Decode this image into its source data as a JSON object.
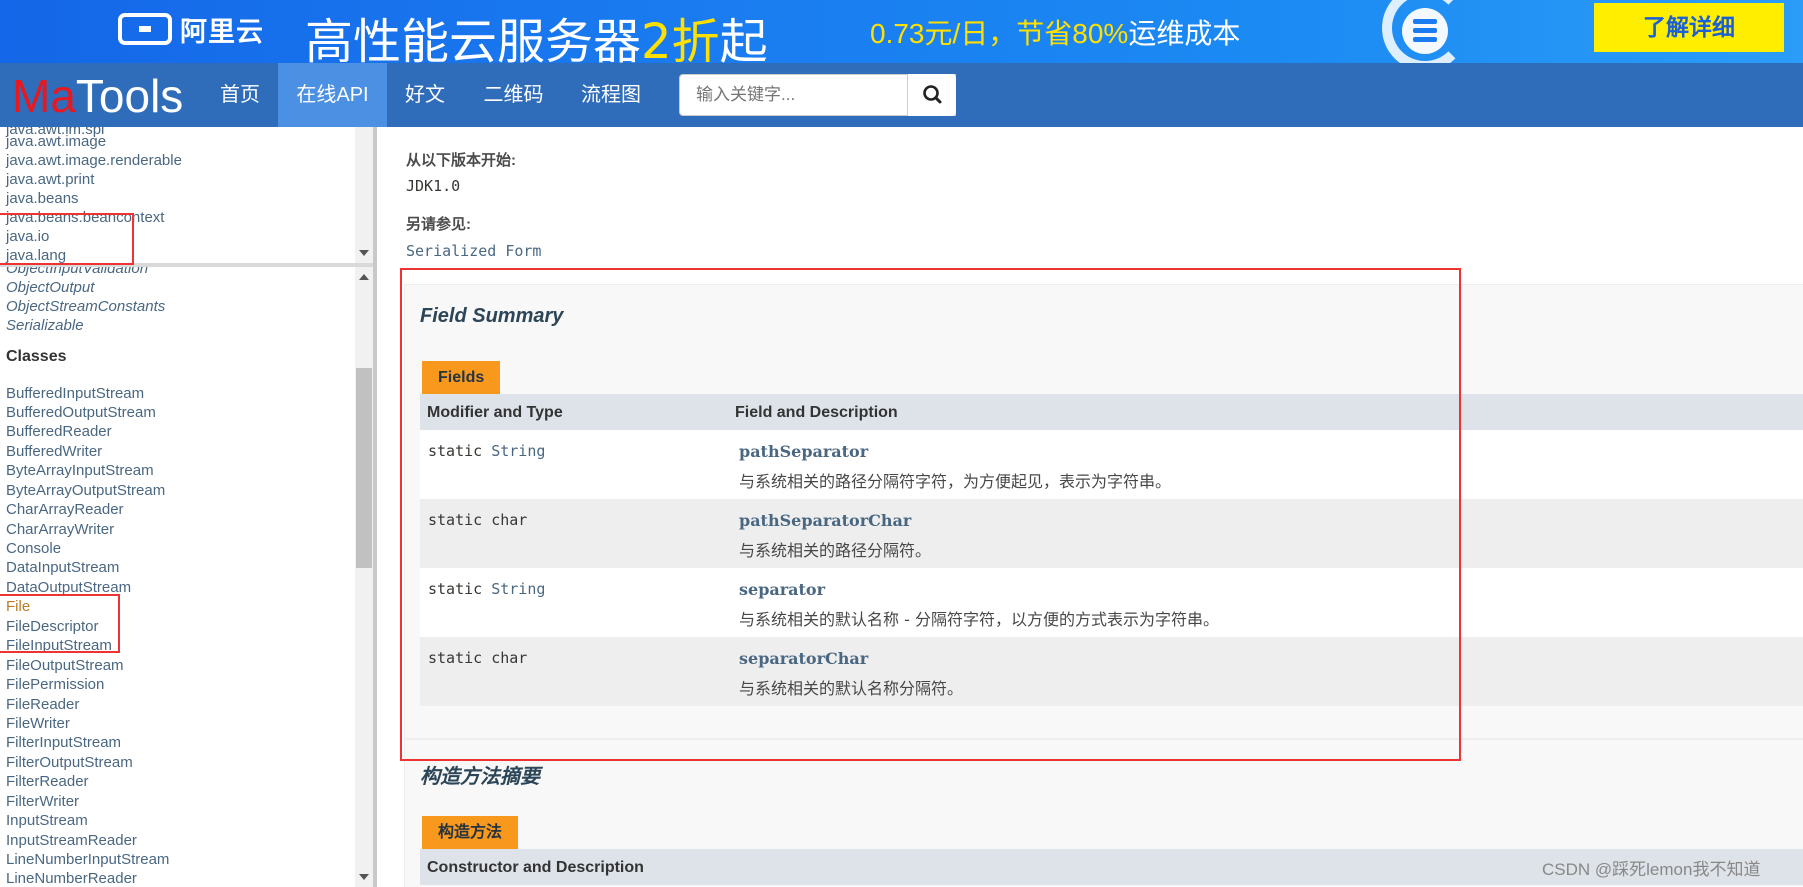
{
  "ad": {
    "brand": "阿里云",
    "headline_pre": "高性能云服务器",
    "headline_hl": "2折",
    "headline_post": "起",
    "sub_pre": "0.73元/日，节省",
    "sub_hl": "80%",
    "sub_post": "运维成本",
    "cta": "了解详细"
  },
  "nav": {
    "brand_red": "Ma",
    "brand_white": "Tools",
    "items": [
      "首页",
      "在线API",
      "好文",
      "二维码",
      "流程图"
    ],
    "active": "在线API",
    "search_placeholder": "输入关键字..."
  },
  "packages": [
    "java.awt.im.spi",
    "java.awt.image",
    "java.awt.image.renderable",
    "java.awt.print",
    "java.beans",
    "java.beans.beancontext",
    "java.io",
    "java.lang"
  ],
  "interfaces_tail": [
    "ObjectInputValidation",
    "ObjectOutput",
    "ObjectStreamConstants",
    "Serializable"
  ],
  "classes_heading": "Classes",
  "classes": [
    "BufferedInputStream",
    "BufferedOutputStream",
    "BufferedReader",
    "BufferedWriter",
    "ByteArrayInputStream",
    "ByteArrayOutputStream",
    "CharArrayReader",
    "CharArrayWriter",
    "Console",
    "DataInputStream",
    "DataOutputStream",
    "File",
    "FileDescriptor",
    "FileInputStream",
    "FileOutputStream",
    "FilePermission",
    "FileReader",
    "FileWriter",
    "FilterInputStream",
    "FilterOutputStream",
    "FilterReader",
    "FilterWriter",
    "InputStream",
    "InputStreamReader",
    "LineNumberInputStream",
    "LineNumberReader"
  ],
  "current_class": "File",
  "content": {
    "since_label": "从以下版本开始:",
    "since_value": "JDK1.0",
    "see_label": "另请参见:",
    "see_value": "Serialized Form",
    "field_summary_title": "Field Summary",
    "fields_caption": "Fields",
    "col_modifier": "Modifier and Type",
    "col_field": "Field and Description",
    "fields": [
      {
        "modifier": "static ",
        "type": "String",
        "name": "pathSeparator",
        "desc": "与系统相关的路径分隔符字符，为方便起见，表示为字符串。"
      },
      {
        "modifier": "static ",
        "type": "char",
        "name": "pathSeparatorChar",
        "desc": "与系统相关的路径分隔符。"
      },
      {
        "modifier": "static ",
        "type": "String",
        "name": "separator",
        "desc": "与系统相关的默认名称 - 分隔符字符，以方便的方式表示为字符串。"
      },
      {
        "modifier": "static ",
        "type": "char",
        "name": "separatorChar",
        "desc": "与系统相关的默认名称分隔符。"
      }
    ],
    "ctor_title": "构造方法摘要",
    "ctor_caption": "构造方法",
    "ctor_col": "Constructor and Description"
  },
  "watermark": "CSDN @踩死lemon我不知道"
}
